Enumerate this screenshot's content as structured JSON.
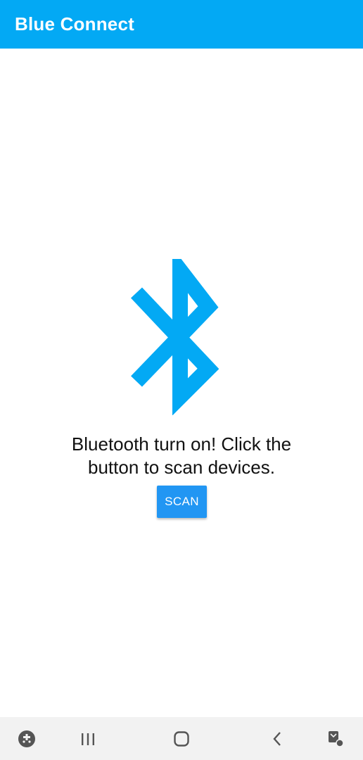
{
  "app_bar": {
    "title": "Blue Connect",
    "color": "#03A9F4"
  },
  "main": {
    "icon": "bluetooth-icon",
    "icon_color": "#03A9F4",
    "message_line1": "Bluetooth turn on! Click the",
    "message_line2": "button to scan devices.",
    "scan_label": "SCAN",
    "scan_color": "#2196F3"
  },
  "nav_bar": {
    "items": [
      "game-launcher-icon",
      "recent-apps-icon",
      "home-icon",
      "back-icon",
      "screen-capture-icon"
    ]
  }
}
